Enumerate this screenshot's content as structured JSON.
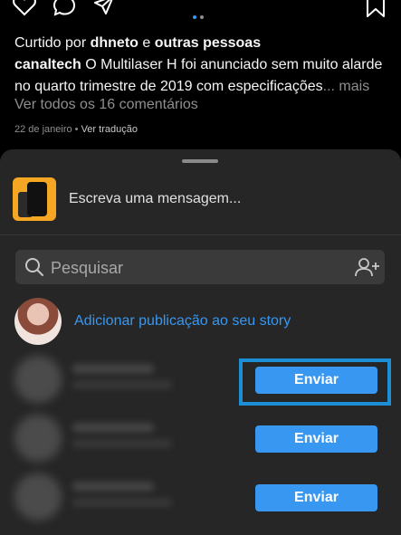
{
  "post": {
    "liked_prefix": "Curtido por ",
    "liked_user": "dhneto",
    "liked_join": " e ",
    "liked_others": "outras pessoas",
    "caption_user": "canaltech",
    "caption_text": " O Multilaser H foi anunciado sem muito alarde no quarto trimestre de 2019 com especificações",
    "caption_more": "... mais",
    "view_comments": "Ver todos os 16 comentários",
    "date": "22 de janeiro",
    "date_sep": " • ",
    "translate": "Ver tradução",
    "icons": [
      "heart-icon",
      "comment-icon",
      "share-icon",
      "bookmark-icon"
    ],
    "carousel_dot_colors": [
      "#3897f0",
      "#8e8e8e"
    ]
  },
  "share_sheet": {
    "message_placeholder": "Escreva uma mensagem...",
    "search_placeholder": "Pesquisar",
    "story_label": "Adicionar publicação ao seu story",
    "contacts": [
      {
        "send_label": "Enviar",
        "highlighted": true
      },
      {
        "send_label": "Enviar",
        "highlighted": false
      },
      {
        "send_label": "Enviar",
        "highlighted": false
      }
    ]
  },
  "colors": {
    "accent": "#3897f0",
    "sheet_bg": "#262626",
    "highlight_border": "#1c8fd6"
  }
}
